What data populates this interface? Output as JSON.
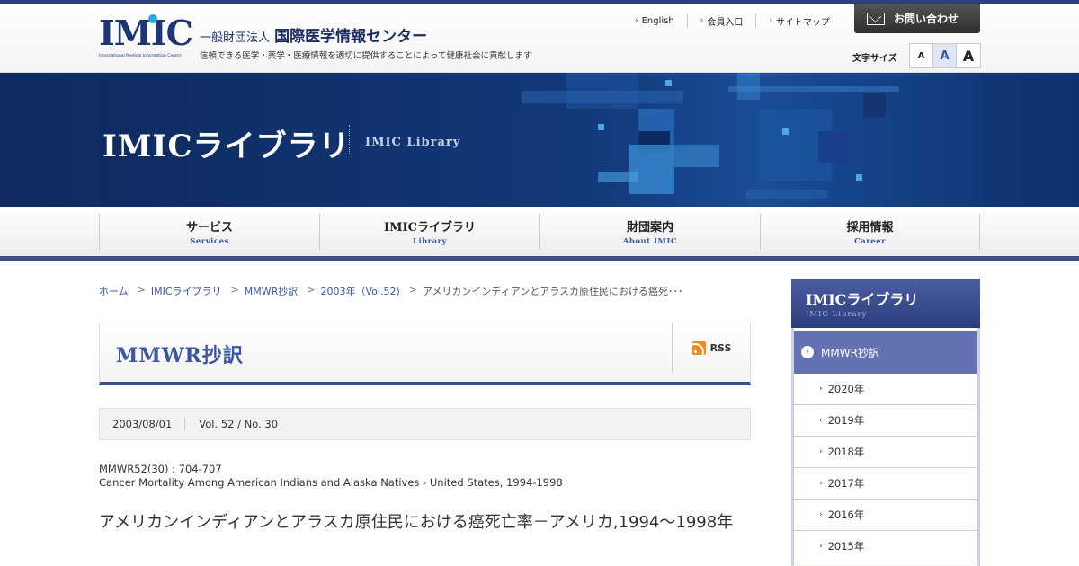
{
  "header": {
    "logo_text": "IMIC",
    "logo_sub": "International Medical Information Center",
    "org_prefix": "一般財団法人",
    "org_name": "国際医学情報センター",
    "tagline": "信頼できる医学・薬学・医療情報を適切に提供することによって健康社会に貢献します",
    "links": [
      "English",
      "会員入口",
      "サイトマップ"
    ],
    "contact_label": "お問い合わせ",
    "font_size_label": "文字サイズ",
    "font_size_buttons": [
      "A",
      "A",
      "A"
    ]
  },
  "hero": {
    "title": "IMICライブラリ",
    "subtitle": "IMIC Library"
  },
  "nav": [
    {
      "jp": "サービス",
      "en": "Services"
    },
    {
      "jp": "IMICライブラリ",
      "en": "Library"
    },
    {
      "jp": "財団案内",
      "en": "About IMIC"
    },
    {
      "jp": "採用情報",
      "en": "Career"
    }
  ],
  "breadcrumb": {
    "items": [
      "ホーム",
      "IMICライブラリ",
      "MMWR抄訳",
      "2003年（Vol.52)"
    ],
    "separator": ">",
    "current": "アメリカンインディアンとアラスカ原住民における癌死･･･"
  },
  "page": {
    "title": "MMWR抄訳",
    "rss_label": "RSS"
  },
  "article": {
    "date": "2003/08/01",
    "volume": "Vol. 52 / No. 30",
    "ref_line1": "MMWR52(30) : 704-707",
    "ref_line2": "Cancer Mortality Among American Indians and Alaska Natives - United States, 1994-1998",
    "title": "アメリカンインディアンとアラスカ原住民における癌死亡率－アメリカ,1994～1998年"
  },
  "sidebar": {
    "title": "IMICライブラリ",
    "subtitle": "IMIC Library",
    "category": "MMWR抄訳",
    "years": [
      "2020年",
      "2019年",
      "2018年",
      "2017年",
      "2016年",
      "2015年"
    ]
  }
}
